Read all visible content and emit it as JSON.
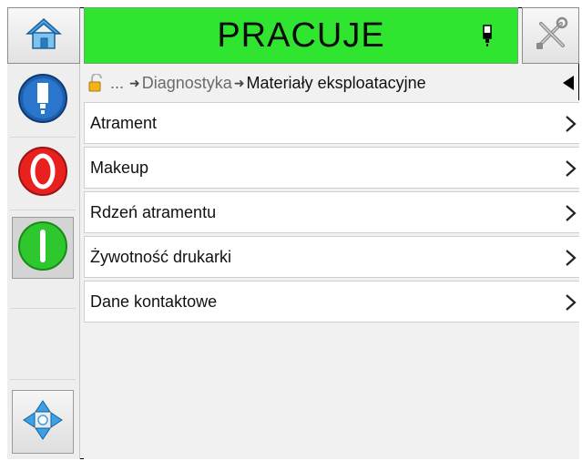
{
  "header": {
    "status_text": "PRACUJE",
    "status_color": "#2fe52f",
    "home_icon": "home-icon",
    "tools_icon": "tools-icon",
    "ink_icon": "ink-cartridge-icon"
  },
  "left_panel": {
    "buttons": [
      {
        "name": "printer-status-button",
        "icon": "printhead-icon",
        "state": "flat"
      },
      {
        "name": "stop-button",
        "icon": "stop-icon",
        "color": "#e8211e",
        "state": "flat"
      },
      {
        "name": "start-button",
        "icon": "start-icon",
        "color": "#2ec82e",
        "state": "pressed"
      },
      {
        "name": "navigation-button",
        "icon": "navigation-arrows-icon",
        "state": "raised"
      }
    ]
  },
  "breadcrumb": {
    "lock_icon": "lock-open-icon",
    "ellipsis": "...",
    "arrow": "➜",
    "parent": "Diagnostyka",
    "current": "Materiały eksploatacyjne",
    "back_icon": "back-arrow-icon"
  },
  "menu": {
    "items": [
      {
        "label": "Atrament"
      },
      {
        "label": "Makeup"
      },
      {
        "label": "Rdzeń atramentu"
      },
      {
        "label": "Żywotność drukarki"
      },
      {
        "label": "Dane kontaktowe"
      }
    ]
  }
}
